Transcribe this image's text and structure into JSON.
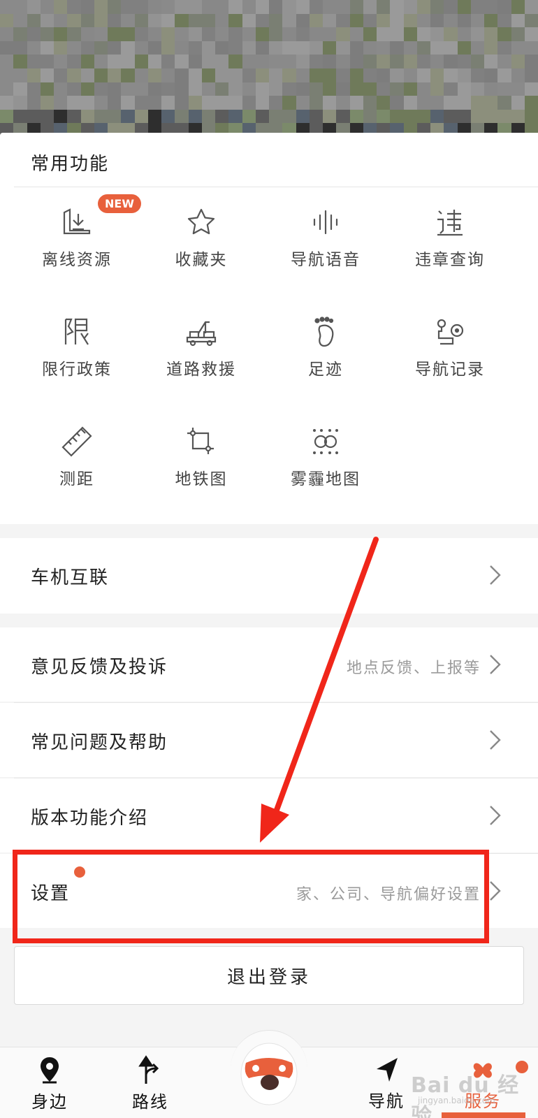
{
  "colors": {
    "accent": "#e8603c",
    "highlight": "#f0261a",
    "text": "#222222",
    "muted": "#9a9a9a"
  },
  "common": {
    "title": "常用功能",
    "new_badge": "NEW",
    "items": [
      {
        "label": "离线资源",
        "icon": "offline-download-icon"
      },
      {
        "label": "收藏夹",
        "icon": "star-icon"
      },
      {
        "label": "导航语音",
        "icon": "voice-wave-icon"
      },
      {
        "label": "违章查询",
        "icon": "violation-icon"
      },
      {
        "label": "限行政策",
        "icon": "restriction-icon"
      },
      {
        "label": "道路救援",
        "icon": "tow-truck-icon"
      },
      {
        "label": "足迹",
        "icon": "footprint-icon"
      },
      {
        "label": "导航记录",
        "icon": "route-record-icon"
      },
      {
        "label": "测距",
        "icon": "ruler-icon"
      },
      {
        "label": "地铁图",
        "icon": "subway-map-icon"
      },
      {
        "label": "雾霾地图",
        "icon": "smog-map-icon"
      }
    ]
  },
  "rows": {
    "car_link": {
      "title": "车机互联"
    },
    "feedback": {
      "title": "意见反馈及投诉",
      "sub": "地点反馈、上报等"
    },
    "faq": {
      "title": "常见问题及帮助"
    },
    "version": {
      "title": "版本功能介绍"
    },
    "settings": {
      "title": "设置",
      "sub": "家、公司、导航偏好设置"
    }
  },
  "logout": {
    "label": "退出登录"
  },
  "tabbar": {
    "tabs": [
      {
        "label": "身边",
        "icon": "location-pin-icon"
      },
      {
        "label": "路线",
        "icon": "route-arrow-icon"
      },
      {
        "label": "导航",
        "icon": "navigate-arrow-icon"
      },
      {
        "label": "服务",
        "icon": "service-grid-icon",
        "active": true
      }
    ]
  },
  "watermark": {
    "text": "Bai du 经验",
    "sub": "jingyan.baidu.com"
  }
}
